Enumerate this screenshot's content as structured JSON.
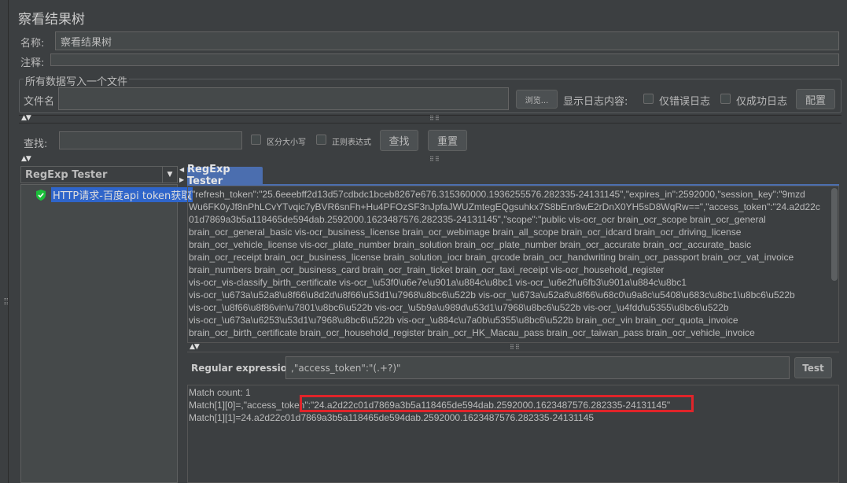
{
  "panel": {
    "title": "察看结果树",
    "name_label": "名称:",
    "name_value": "察看结果树",
    "comment_label": "注释:",
    "comment_value": ""
  },
  "file_section": {
    "legend": "所有数据写入一个文件",
    "filename_label": "文件名",
    "filename_value": "",
    "browse_label": "浏览...",
    "log_content_label": "显示日志内容:",
    "errors_only_label": "仅错误日志",
    "success_only_label": "仅成功日志",
    "config_label": "配置"
  },
  "search": {
    "label": "查找:",
    "value": "",
    "case_sensitive_label": "区分大小写",
    "regex_label": "正则表达式",
    "find_label": "查找",
    "reset_label": "重置"
  },
  "left_panel": {
    "renderer_selected": "RegExp Tester",
    "tree_item": "HTTP请求-百度api token获取"
  },
  "right_panel": {
    "tab_label": "RegExp Tester",
    "response_lines": [
      "{\"refresh_token\":\"25.6eeebff2d13d57cdbdc1bceb8267e676.315360000.1936255576.282335-24131145\",\"expires_in\":2592000,\"session_key\":\"9mzd",
      "Wu6FK0yJf8nPhLCvYTvqic7yBVR6snFh+Hu4PFOzSF3nJpfaJWUZmtegEQgsuhkx7S8bEnr8wE2rDnX0YH5sD8WqRw==\",\"access_token\":\"24.a2d22c",
      "01d7869a3b5a118465de594dab.2592000.1623487576.282335-24131145\",\"scope\":\"public vis-ocr_ocr brain_ocr_scope brain_ocr_general",
      "brain_ocr_general_basic vis-ocr_business_license brain_ocr_webimage brain_all_scope brain_ocr_idcard brain_ocr_driving_license",
      "brain_ocr_vehicle_license vis-ocr_plate_number brain_solution brain_ocr_plate_number brain_ocr_accurate brain_ocr_accurate_basic",
      "brain_ocr_receipt brain_ocr_business_license brain_solution_iocr brain_qrcode brain_ocr_handwriting brain_ocr_passport brain_ocr_vat_invoice",
      "brain_numbers brain_ocr_business_card brain_ocr_train_ticket brain_ocr_taxi_receipt vis-ocr_household_register",
      "vis-ocr_vis-classify_birth_certificate vis-ocr_\\u53f0\\u6e7e\\u901a\\u884c\\u8bc1 vis-ocr_\\u6e2f\\u6fb3\\u901a\\u884c\\u8bc1",
      "vis-ocr_\\u673a\\u52a8\\u8f66\\u8d2d\\u8f66\\u53d1\\u7968\\u8bc6\\u522b vis-ocr_\\u673a\\u52a8\\u8f66\\u68c0\\u9a8c\\u5408\\u683c\\u8bc1\\u8bc6\\u522b",
      "vis-ocr_\\u8f66\\u8f86vin\\u7801\\u8bc6\\u522b vis-ocr_\\u5b9a\\u989d\\u53d1\\u7968\\u8bc6\\u522b vis-ocr_\\u4fdd\\u5355\\u8bc6\\u522b",
      "vis-ocr_\\u673a\\u6253\\u53d1\\u7968\\u8bc6\\u522b vis-ocr_\\u884c\\u7a0b\\u5355\\u8bc6\\u522b brain_ocr_vin brain_ocr_quota_invoice",
      "brain_ocr_birth_certificate brain_ocr_household_register brain_ocr_HK_Macau_pass brain_ocr_taiwan_pass brain_ocr_vehicle_invoice"
    ],
    "regex_label": "Regular expression:",
    "regex_value": ",\"access_token\":\"(.+?)\"",
    "test_label": "Test",
    "match_count": "Match count: 1",
    "match_0_prefix": "Match[1][0]=,\"access_toke",
    "match_0_tail": "n\":\"",
    "match_0_highlight": "24.a2d22c01d7869a3b5a118465de594dab.2592000.1623487576.282335-24131145\"",
    "match_1": "Match[1][1]=24.a2d22c01d7869a3b5a118465de594dab.2592000.1623487576.282335-24131145"
  },
  "colors": {
    "background": "#3c3f41",
    "tab_active": "#4b6eaf",
    "tree_selected": "#2f65ca",
    "highlight_border": "#e0242a",
    "check_icon": "#1bbf3a"
  }
}
